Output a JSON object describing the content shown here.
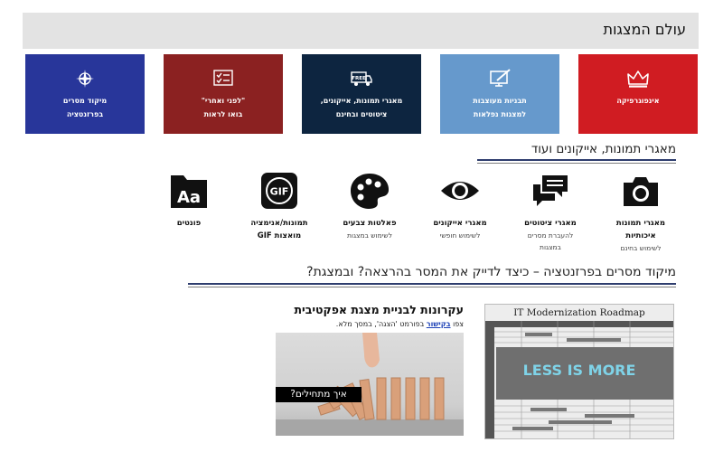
{
  "header": {
    "title": "עולם המצגות"
  },
  "tiles": [
    {
      "label": "אינפוגרפיקה",
      "icon": "crown-icon",
      "color": "#d01c22"
    },
    {
      "label": "תבניות מעוצבות\nלמצגות נפלאות",
      "icon": "edit-screen-icon",
      "color": "#6699cc"
    },
    {
      "label": "מאגרי תמונות, אייקונים,\nציטוטים ובחינם",
      "icon": "free-truck-icon",
      "color": "#0d2540"
    },
    {
      "label": "\"לפני ואחרי\"\nבואו לראות",
      "icon": "checklist-icon",
      "color": "#8b2121"
    },
    {
      "label": "מיקוד מסרים\nבפרזנטציה",
      "icon": "compass-icon",
      "color": "#28369a"
    }
  ],
  "section1": {
    "title": "מאגרי תמונות, אייקונים ועוד"
  },
  "categories": [
    {
      "title": "מאגרי תמונות\nאיכותיות",
      "subtitle": "לשימוש בחינם",
      "icon": "camera-icon"
    },
    {
      "title": "מאגרי ציטוטים",
      "subtitle": "להעברת מסרים\nבמצגות",
      "icon": "quote-bubbles-icon"
    },
    {
      "title": "מאגרי אייקונים",
      "subtitle": "לשימוש חופשי",
      "icon": "eye-icon"
    },
    {
      "title": "פאלטות צבעים",
      "subtitle": "לשימוש במצגות",
      "icon": "palette-icon"
    },
    {
      "title": "תמונות/אנימציה\nמואצות GIF",
      "subtitle": "",
      "icon": "gif-icon"
    },
    {
      "title": "פונטים",
      "subtitle": "",
      "icon": "font-folder-icon"
    }
  ],
  "section2": {
    "title": "מיקוד מסרים בפרזנטציה – כיצד לדייק את המסר בהרצאה? ובמצגת?"
  },
  "article": {
    "title": "עקרונות לבניית מצגת אפקטיבית",
    "prefix": "צפו",
    "link": "בקישור",
    "suffix": "בפורמט 'הצגה', במסך מלא.",
    "image_caption": "איך מתחילים?"
  },
  "roadmap": {
    "title": "IT Modernization Roadmap",
    "overlay": "LESS IS MORE"
  }
}
